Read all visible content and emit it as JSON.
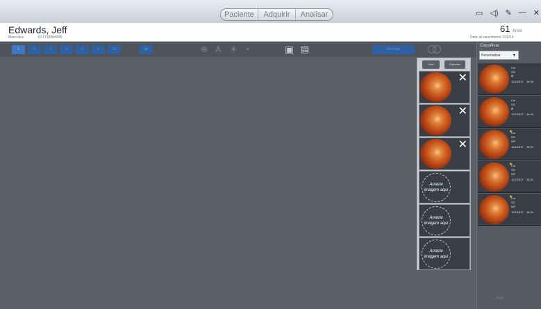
{
  "header": {
    "tabs": [
      "Paciente",
      "Adquirir",
      "Analisar"
    ],
    "window_icons": [
      "monitor-icon",
      "speaker-icon",
      "tools-icon",
      "minimize-icon",
      "close-icon"
    ]
  },
  "patient": {
    "name": "Edwards, Jeff",
    "sex": "Masculino",
    "id": "ID 1718984308",
    "age": "61",
    "age_unit": "Anos",
    "dob": "Data de nascimento 7/22/19"
  },
  "toolbar": {
    "pages": [
      "1",
      "2",
      "3",
      "4",
      "5",
      "6",
      "16"
    ],
    "montage_label": "Montage"
  },
  "montage_panel": {
    "create_label": "Criar",
    "cancel_label": "Cancelar",
    "drop_text": "Arraste imagem aqui"
  },
  "right_panel": {
    "title": "Classificar",
    "sort_value": "Personalizar",
    "thumbs": [
      {
        "l1": "Cor",
        "l2": "OD",
        "l3": "⊞",
        "date": "11/1/2017",
        "time": "16:35",
        "star": false
      },
      {
        "l1": "Cor",
        "l2": "OD",
        "l3": "⊞",
        "date": "11/1/2017",
        "time": "16:35",
        "star": false
      },
      {
        "l1": "Cor",
        "l2": "OD",
        "l3": "WF",
        "date": "11/1/2017",
        "time": "16:34",
        "star": true
      },
      {
        "l1": "Cor",
        "l2": "OD",
        "l3": "WF",
        "date": "11/1/2017",
        "time": "16:34",
        "star": true
      },
      {
        "l1": "Cor",
        "l2": "OD",
        "l3": "WF",
        "date": "11/1/2017",
        "time": "16:34",
        "star": true
      }
    ],
    "print_label": "Print"
  }
}
